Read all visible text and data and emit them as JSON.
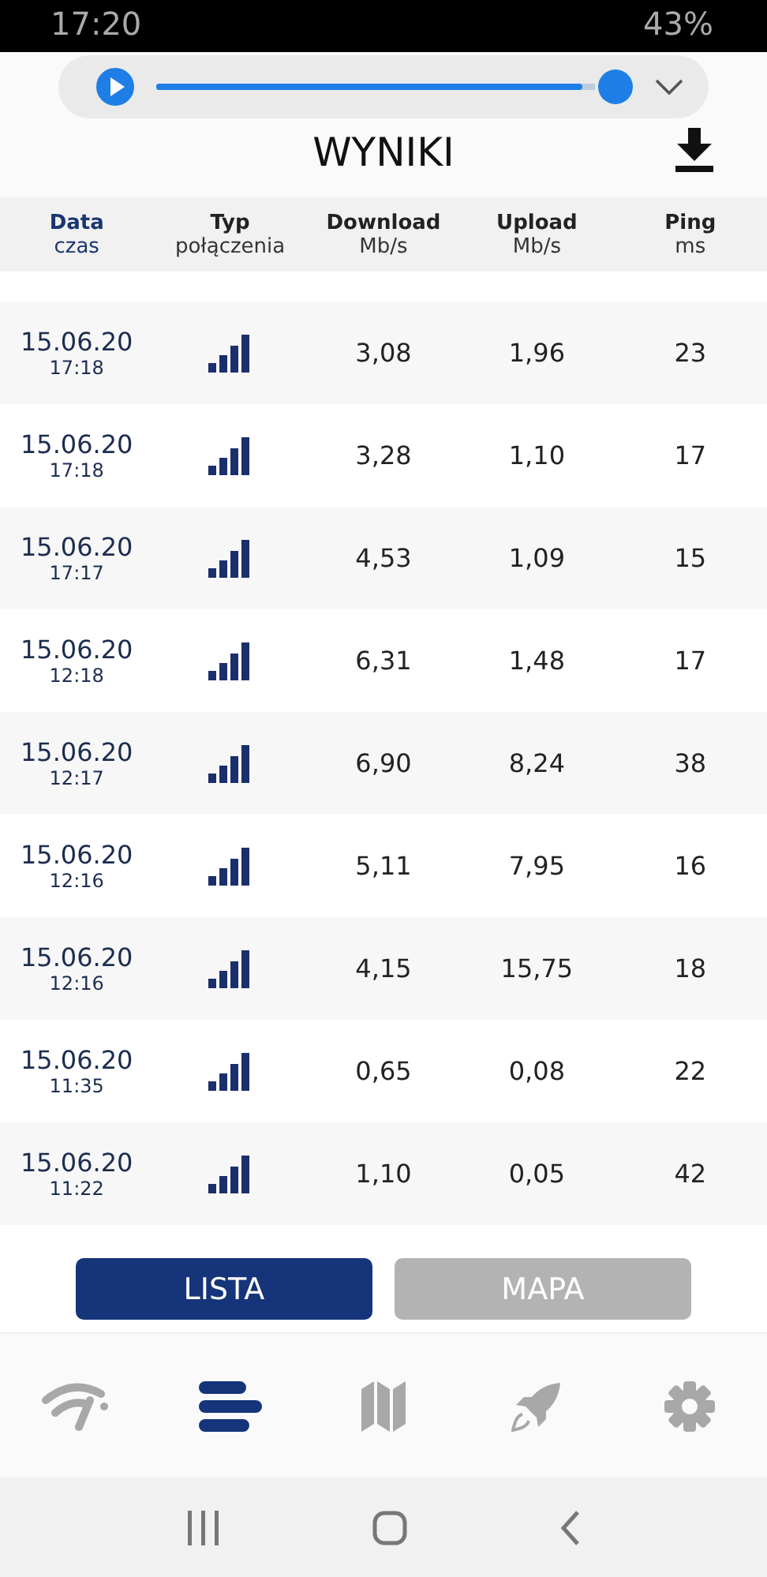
{
  "status_bar": {
    "time": "17:20",
    "battery": "43%"
  },
  "media_player": {
    "level": 0.97
  },
  "header": {
    "title": "WYNIKI"
  },
  "table": {
    "columns": [
      {
        "title": "Data",
        "subtitle": "czas",
        "selected": true
      },
      {
        "title": "Typ",
        "subtitle": "połączenia",
        "selected": false
      },
      {
        "title": "Download",
        "subtitle": "Mb/s",
        "selected": false
      },
      {
        "title": "Upload",
        "subtitle": "Mb/s",
        "selected": false
      },
      {
        "title": "Ping",
        "subtitle": "ms",
        "selected": false
      }
    ],
    "rows": [
      {
        "date": "15.06.20",
        "time": "17:18",
        "download": "3,08",
        "upload": "1,96",
        "ping": "23"
      },
      {
        "date": "15.06.20",
        "time": "17:18",
        "download": "3,28",
        "upload": "1,10",
        "ping": "17"
      },
      {
        "date": "15.06.20",
        "time": "17:17",
        "download": "4,53",
        "upload": "1,09",
        "ping": "15"
      },
      {
        "date": "15.06.20",
        "time": "12:18",
        "download": "6,31",
        "upload": "1,48",
        "ping": "17"
      },
      {
        "date": "15.06.20",
        "time": "12:17",
        "download": "6,90",
        "upload": "8,24",
        "ping": "38"
      },
      {
        "date": "15.06.20",
        "time": "12:16",
        "download": "5,11",
        "upload": "7,95",
        "ping": "16"
      },
      {
        "date": "15.06.20",
        "time": "12:16",
        "download": "4,15",
        "upload": "15,75",
        "ping": "18"
      },
      {
        "date": "15.06.20",
        "time": "11:35",
        "download": "0,65",
        "upload": "0,08",
        "ping": "22"
      },
      {
        "date": "15.06.20",
        "time": "11:22",
        "download": "1,10",
        "upload": "0,05",
        "ping": "42"
      }
    ]
  },
  "view_toggle": [
    {
      "label": "LISTA",
      "selected": true
    },
    {
      "label": "MAPA",
      "selected": false
    }
  ],
  "bottom_nav": [
    {
      "kind": "speed",
      "selected": false
    },
    {
      "kind": "list",
      "selected": true
    },
    {
      "kind": "map",
      "selected": false
    },
    {
      "kind": "rocket",
      "selected": false
    },
    {
      "kind": "settings",
      "selected": false
    }
  ]
}
